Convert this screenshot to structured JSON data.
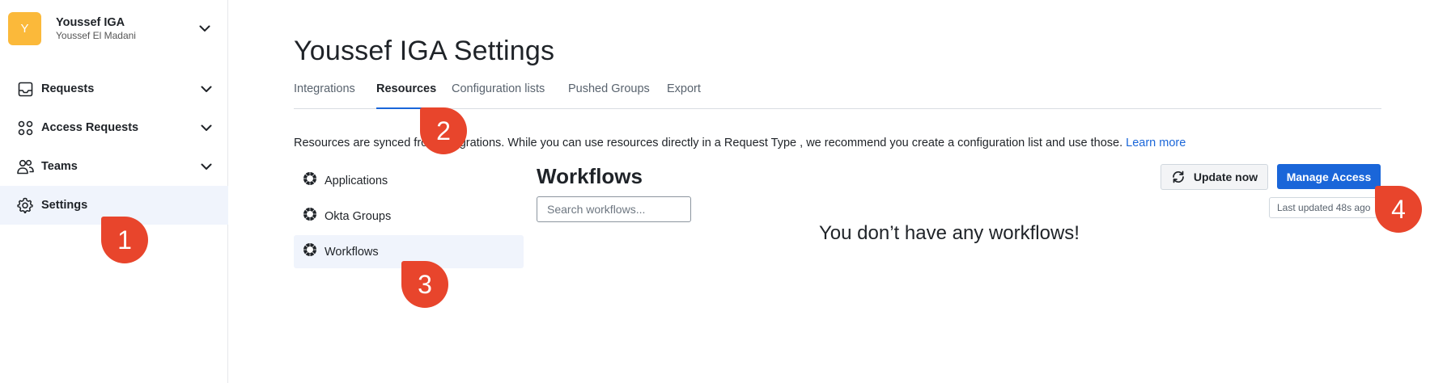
{
  "workspace": {
    "avatar_letter": "Y",
    "name": "Youssef IGA",
    "user": "Youssef El Madani",
    "avatar_color": "#fbb93a"
  },
  "sidebar": {
    "items": [
      {
        "label": "Requests",
        "icon": "inbox-icon"
      },
      {
        "label": "Access Requests",
        "icon": "grid-circles-icon"
      },
      {
        "label": "Teams",
        "icon": "users-icon"
      },
      {
        "label": "Settings",
        "icon": "gear-icon",
        "active": true
      }
    ]
  },
  "page": {
    "title": "Youssef IGA Settings",
    "tabs": [
      {
        "label": "Integrations"
      },
      {
        "label": "Resources",
        "active": true
      },
      {
        "label": "Configuration lists"
      },
      {
        "label": "Pushed Groups"
      },
      {
        "label": "Export"
      }
    ],
    "info": {
      "text": "Resources are synced from integrations. While you can use resources directly in a Request Type , we recommend you create a configuration list and use those.",
      "link": "Learn more"
    }
  },
  "resources": {
    "items": [
      {
        "label": "Applications",
        "icon": "okta-icon"
      },
      {
        "label": "Okta Groups",
        "icon": "okta-icon"
      },
      {
        "label": "Workflows",
        "icon": "okta-icon",
        "active": true
      }
    ]
  },
  "workflows": {
    "title": "Workflows",
    "search_placeholder": "Search workflows...",
    "update_label": "Update now",
    "manage_label": "Manage Access",
    "last_updated": "Last updated 48s ago",
    "empty_message": "You don’t have any workflows!"
  },
  "markers": [
    "1",
    "2",
    "3",
    "4"
  ],
  "colors": {
    "accent": "#1a66d9",
    "marker": "#e8452c",
    "active_bg": "#f0f4fc"
  }
}
